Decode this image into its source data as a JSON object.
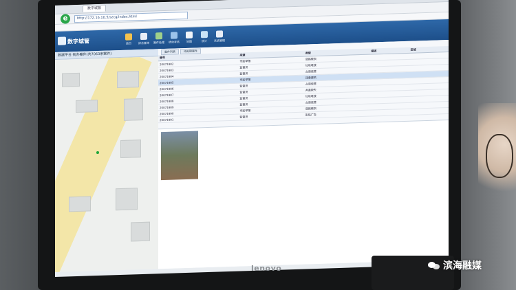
{
  "browser": {
    "tab_label": "数字城管",
    "url": "http://172.16.10.5/szcg/index.html"
  },
  "app": {
    "brand": "数字城管",
    "panel_title": "数据平台 街办案件(共7063条案件)"
  },
  "nav": [
    {
      "label": "首页",
      "color": "#f2c14e"
    },
    {
      "label": "综合查询",
      "color": "#e8eef7"
    },
    {
      "label": "案件处理",
      "color": "#9fd08a"
    },
    {
      "label": "绩效考核",
      "color": "#9cc3ea"
    },
    {
      "label": "地图",
      "color": "#f0f4f9"
    },
    {
      "label": "统计",
      "color": "#c9e3f6"
    },
    {
      "label": "系统管理",
      "color": "#e8eef7"
    }
  ],
  "grid": {
    "tabs": [
      "案件列表",
      "待处理案件"
    ],
    "columns": [
      "编号",
      "来源",
      "类型",
      "描述",
      "区域"
    ],
    "rows": [
      {
        "id": "20071882",
        "src": "市民举报",
        "type": "道路破损",
        "desc": "",
        "area": ""
      },
      {
        "id": "20071883",
        "src": "监督员",
        "type": "垃圾堆放",
        "desc": "",
        "area": ""
      },
      {
        "id": "20071884",
        "src": "监督员",
        "type": "占道经营",
        "desc": "",
        "area": ""
      },
      {
        "id": "20071885",
        "src": "市民举报",
        "type": "违章建筑",
        "desc": "",
        "area": ""
      },
      {
        "id": "20071886",
        "src": "监督员",
        "type": "占道经营",
        "desc": "",
        "area": ""
      },
      {
        "id": "20071887",
        "src": "监督员",
        "type": "井盖缺失",
        "desc": "",
        "area": ""
      },
      {
        "id": "20071888",
        "src": "监督员",
        "type": "垃圾堆放",
        "desc": "",
        "area": ""
      },
      {
        "id": "20071889",
        "src": "监督员",
        "type": "占道经营",
        "desc": "",
        "area": ""
      },
      {
        "id": "20071890",
        "src": "市民举报",
        "type": "道路破损",
        "desc": "",
        "area": ""
      },
      {
        "id": "20071891",
        "src": "监督员",
        "type": "乱贴广告",
        "desc": "",
        "area": ""
      }
    ]
  },
  "monitor_brand": "lenovo",
  "watermark": "滨海融媒",
  "colors": {
    "header": "#1d4f8a",
    "road": "#f3e6a8",
    "selected_row": "#cfe0f4"
  }
}
